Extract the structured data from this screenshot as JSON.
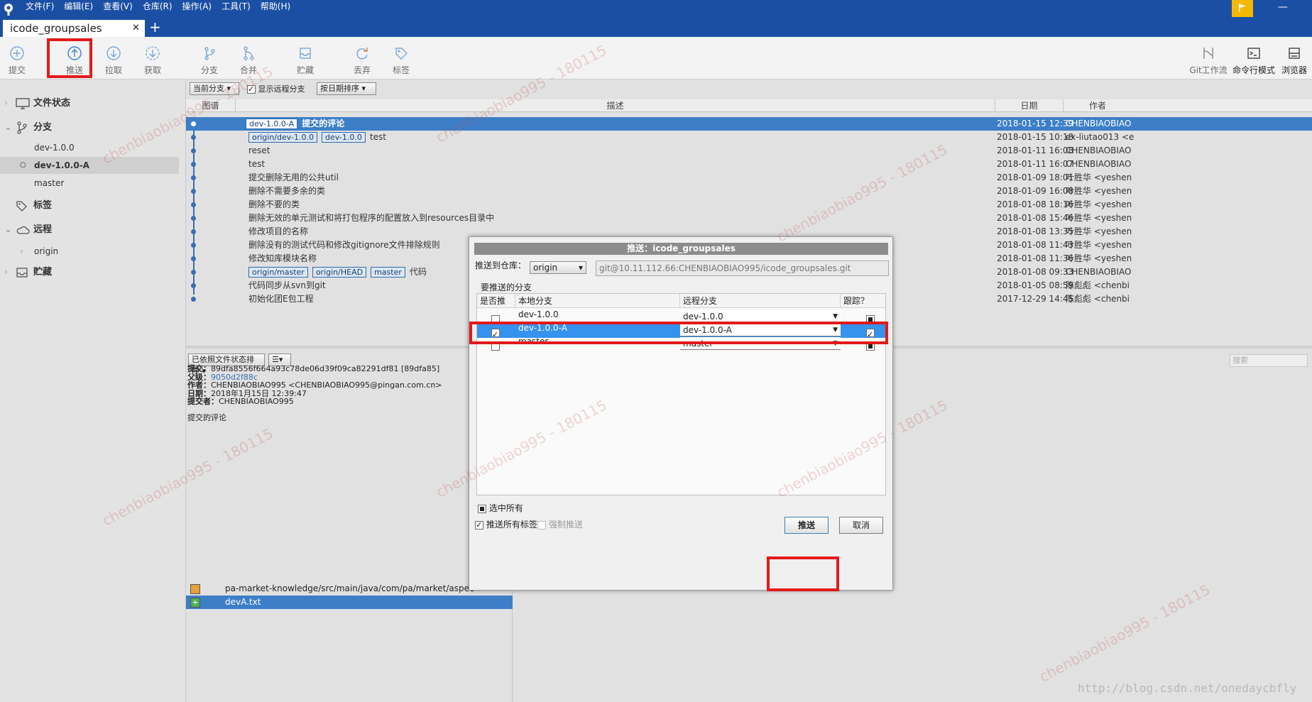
{
  "menu": {
    "items": [
      "文件(F)",
      "编辑(E)",
      "查看(V)",
      "仓库(R)",
      "操作(A)",
      "工具(T)",
      "帮助(H)"
    ],
    "minimize": "—"
  },
  "tabs": {
    "active": "icode_groupsales",
    "close": "✕",
    "add": "+"
  },
  "toolbar": {
    "commit": "提交",
    "push": "推送",
    "pull": "拉取",
    "fetch": "获取",
    "branch": "分支",
    "merge": "合并",
    "stash": "贮藏",
    "discard": "丢弃",
    "tag": "标签",
    "gitflow": "Git工作流",
    "terminal": "命令行模式",
    "explorer": "浏览器"
  },
  "sidebar": {
    "file_status": "文件状态",
    "branches": "分支",
    "branch_items": [
      "dev-1.0.0",
      "dev-1.0.0-A",
      "master"
    ],
    "tags": "标签",
    "remotes": "远程",
    "remote_items": [
      "origin"
    ],
    "stashes": "贮藏"
  },
  "log": {
    "filter_branch": "当前分支",
    "show_remote": "显示远程分支",
    "sort": "按日期排序",
    "col_graph": "图谱",
    "col_desc": "描述",
    "col_date": "日期",
    "col_author": "作者",
    "rows": [
      {
        "labels": [
          "dev-1.0.0-A"
        ],
        "msg": "提交的评论",
        "date": "2018-01-15 12:39",
        "author": "CHENBIAOBIAO"
      },
      {
        "labels": [
          "origin/dev-1.0.0",
          "dev-1.0.0"
        ],
        "msg": "test",
        "date": "2018-01-15 10:18",
        "author": "ex-liutao013 <e"
      },
      {
        "labels": [],
        "msg": "reset",
        "date": "2018-01-11 16:08",
        "author": "CHENBIAOBIAO"
      },
      {
        "labels": [],
        "msg": "test",
        "date": "2018-01-11 16:07",
        "author": "CHENBIAOBIAO"
      },
      {
        "labels": [],
        "msg": "提交删除无用的公共util",
        "date": "2018-01-09 18:01",
        "author": "叶胜华 <yeshen"
      },
      {
        "labels": [],
        "msg": "删除不需要多余的类",
        "date": "2018-01-09 16:08",
        "author": "叶胜华 <yeshen"
      },
      {
        "labels": [],
        "msg": "删除不要的类",
        "date": "2018-01-08 18:16",
        "author": "叶胜华 <yeshen"
      },
      {
        "labels": [],
        "msg": "删除无效的单元测试和将打包程序的配置放入到resources目录中",
        "date": "2018-01-08 15:46",
        "author": "叶胜华 <yeshen"
      },
      {
        "labels": [],
        "msg": "修改项目的名称",
        "date": "2018-01-08 13:35",
        "author": "叶胜华 <yeshen"
      },
      {
        "labels": [],
        "msg": "删除没有的测试代码和修改gitignore文件排除规则",
        "date": "2018-01-08 11:43",
        "author": "叶胜华 <yeshen"
      },
      {
        "labels": [],
        "msg": "修改知库模块名称",
        "date": "2018-01-08 11:36",
        "author": "叶胜华 <yeshen"
      },
      {
        "labels": [
          "origin/master",
          "origin/HEAD",
          "master"
        ],
        "msg": "代码",
        "date": "2018-01-08 09:33",
        "author": "CHENBIAOBIAO"
      },
      {
        "labels": [],
        "msg": "代码同步从svn到git",
        "date": "2018-01-05 08:59",
        "author": "陈彪彪 <chenbi"
      },
      {
        "labels": [],
        "msg": "初始化团E包工程",
        "date": "2017-12-29 14:45",
        "author": "陈彪彪 <chenbi"
      }
    ]
  },
  "detail": {
    "sort_mode": "已依照文件状态排序",
    "view_mode": "☰",
    "search_placeholder": "搜索",
    "commit_label": "提交：",
    "commit_value": "89dfa8556f664a93c78de06d39f09ca82291df81 [89dfa85]",
    "parent_label": "父级：",
    "parent_value": "9050d2f88c",
    "author_label": "作者：",
    "author_value": "CHENBIAOBIAO995 <CHENBIAOBIAO995@pingan.com.cn>",
    "date_label": "日期：",
    "date_value": "2018年1月15日 12:39:47",
    "committer_label": "提交者：",
    "committer_value": "CHENBIAOBIAO995",
    "message": "提交的评论",
    "files": [
      "pa-market-knowledge/src/main/java/com/pa/market/aspec",
      "devA.txt"
    ]
  },
  "dialog": {
    "title": "推送：icode_groupsales",
    "push_to_label": "推送到仓库：",
    "remote": "origin",
    "remote_url": "git@10.11.112.66:CHENBIAOBIAO995/icode_groupsales.git",
    "branches_label": "要推送的分支",
    "col_push": "是否推",
    "col_local": "本地分支",
    "col_remote": "远程分支",
    "col_track": "跟踪？",
    "branches": [
      {
        "local": "dev-1.0.0",
        "remote": "dev-1.0.0",
        "push": false,
        "track": true
      },
      {
        "local": "dev-1.0.0-A",
        "remote": "dev-1.0.0-A",
        "push": true,
        "track": true
      },
      {
        "local": "master",
        "remote": "master",
        "push": false,
        "track": true
      }
    ],
    "select_all": "选中所有",
    "push_all_tags": "推送所有标签",
    "force_push": "强制推送",
    "push_button": "推送",
    "cancel_button": "取消"
  },
  "watermarks": [
    "chenbiaobiao995 - 180115"
  ],
  "footer_url": "http://blog.csdn.net/onedaycbfly",
  "colors": {
    "accent": "#1b4fa3",
    "selection": "#3d7ec8",
    "highlight": "#e21a1a"
  }
}
